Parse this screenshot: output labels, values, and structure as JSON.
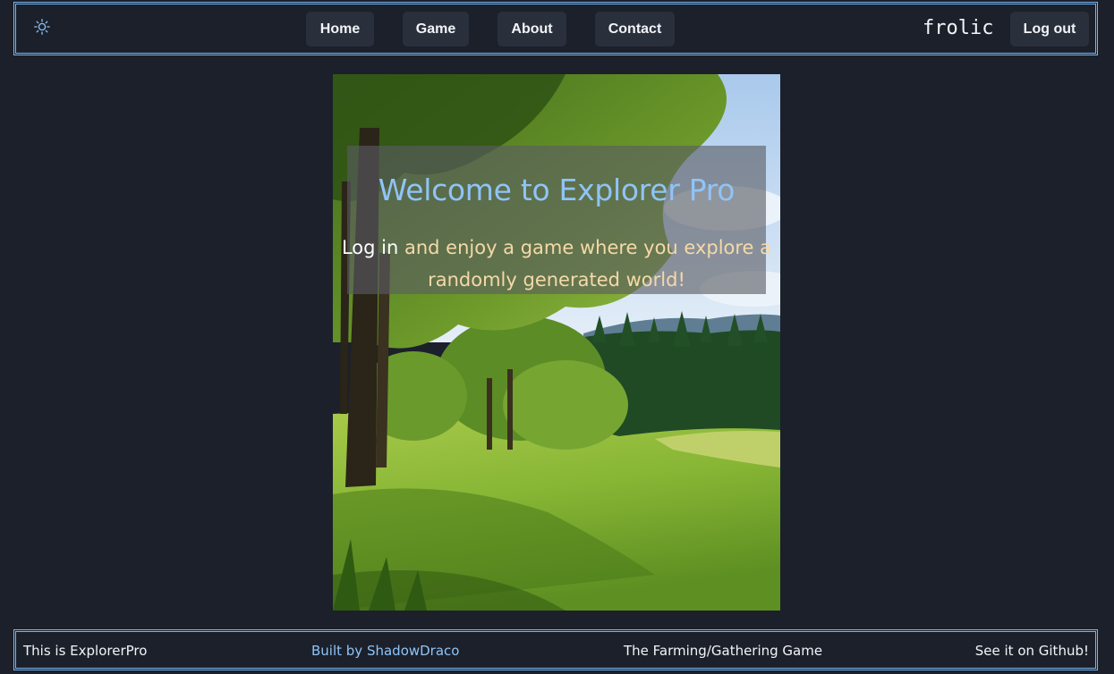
{
  "header": {
    "theme_icon": "sun-icon",
    "nav": [
      {
        "label": "Home"
      },
      {
        "label": "Game"
      },
      {
        "label": "About"
      },
      {
        "label": "Contact"
      }
    ],
    "brand": "frolic",
    "logout_label": "Log out"
  },
  "hero": {
    "title": "Welcome to Explorer Pro",
    "login_link": "Log in",
    "tagline": " and enjoy a game where you explore a randomly generated world!",
    "image": "forest meadow landscape"
  },
  "footer": {
    "left": "This is ExplorerPro",
    "credit": "Built by ShadowDraco",
    "middle": "The Farming/Gathering Game",
    "right": "See it on Github!"
  },
  "colors": {
    "background": "#1b202b",
    "border": "#78b4f0",
    "button": "#2a2f3c",
    "title": "#8fc4f7",
    "tagline": "#f5d9a8"
  }
}
